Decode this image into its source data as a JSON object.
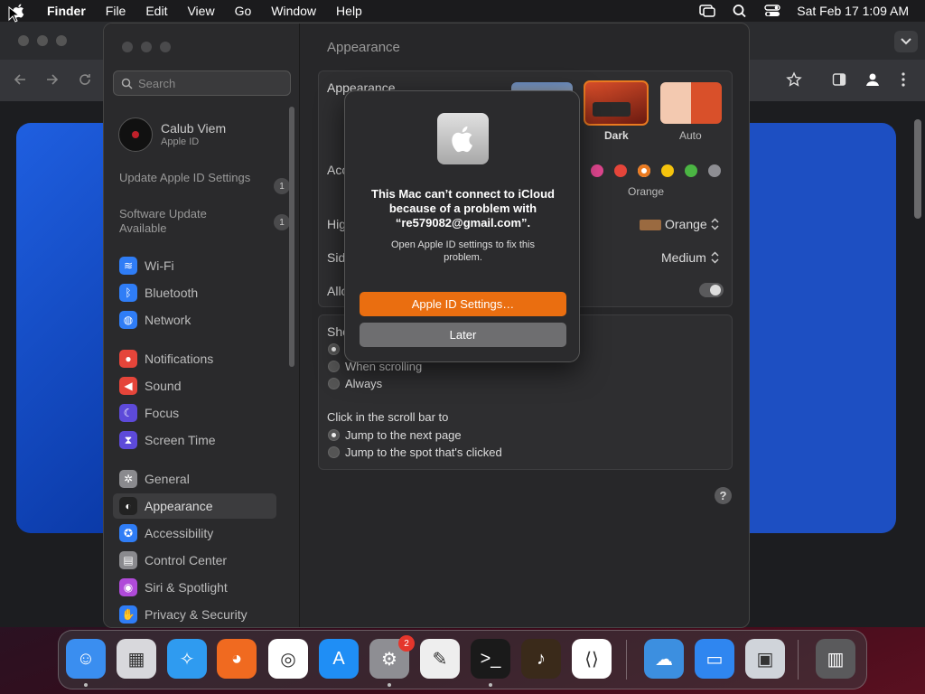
{
  "menubar": {
    "app": "Finder",
    "items": [
      "File",
      "Edit",
      "View",
      "Go",
      "Window",
      "Help"
    ],
    "datetime": "Sat Feb 17  1:09 AM"
  },
  "sidebar": {
    "search_placeholder": "Search",
    "user": {
      "name": "Calub Viem",
      "sub": "Apple ID"
    },
    "alerts": [
      {
        "label": "Update Apple ID Settings",
        "badge": "1"
      },
      {
        "label": "Software Update Available",
        "badge": "1"
      }
    ],
    "items": [
      {
        "label": "Wi-Fi",
        "icon": "wifi-icon",
        "color": "#2f7df6"
      },
      {
        "label": "Bluetooth",
        "icon": "bluetooth-icon",
        "color": "#2f7df6"
      },
      {
        "label": "Network",
        "icon": "globe-icon",
        "color": "#2f7df6"
      },
      {
        "label": "Notifications",
        "icon": "bell-icon",
        "color": "#e5453a"
      },
      {
        "label": "Sound",
        "icon": "speaker-icon",
        "color": "#e5453a"
      },
      {
        "label": "Focus",
        "icon": "moon-icon",
        "color": "#5d4ad9"
      },
      {
        "label": "Screen Time",
        "icon": "hourglass-icon",
        "color": "#5d4ad9"
      },
      {
        "label": "General",
        "icon": "gear-icon",
        "color": "#8a8a8e"
      },
      {
        "label": "Appearance",
        "icon": "appearance-icon",
        "color": "#222"
      },
      {
        "label": "Accessibility",
        "icon": "accessibility-icon",
        "color": "#2f7df6"
      },
      {
        "label": "Control Center",
        "icon": "control-center-icon",
        "color": "#8a8a8e"
      },
      {
        "label": "Siri & Spotlight",
        "icon": "siri-icon",
        "color": "#b04ad9"
      },
      {
        "label": "Privacy & Security",
        "icon": "hand-icon",
        "color": "#2f7df6"
      }
    ]
  },
  "main": {
    "title": "Appearance",
    "appearance_label": "Appearance",
    "modes": [
      "Dark",
      "Auto"
    ],
    "accent_label": "Acc",
    "accent_selected": "Orange",
    "accent_colors": [
      "#e0468f",
      "#e5453a",
      "#ea7a20",
      "#f4c30d",
      "#4bb543",
      "#8e8e93"
    ],
    "highlight_label": "Hig",
    "highlight_value": "Orange",
    "sidebar_label": "Sid",
    "sidebar_value": "Medium",
    "allow_label": "Allo",
    "scrollbar": {
      "show_label": "Sho",
      "options": [
        "When scrolling",
        "Always"
      ],
      "click_label": "Click in the scroll bar to",
      "click_options": [
        "Jump to the next page",
        "Jump to the spot that's clicked"
      ]
    },
    "help": "?"
  },
  "dialog": {
    "title": "This Mac can’t connect to iCloud because of a problem with “re579082@gmail.com”.",
    "message": "Open Apple ID settings to fix this problem.",
    "primary": "Apple ID Settings…",
    "secondary": "Later"
  },
  "dock": {
    "apps": [
      {
        "name": "finder-icon",
        "color": "#3a8ef0"
      },
      {
        "name": "launchpad-icon",
        "color": "#d8d8dc"
      },
      {
        "name": "safari-icon",
        "color": "#2f9bf0"
      },
      {
        "name": "firefox-icon",
        "color": "#f06a20"
      },
      {
        "name": "chrome-icon",
        "color": "#ffffff"
      },
      {
        "name": "app-store-icon",
        "color": "#1f8ef5"
      },
      {
        "name": "system-settings-icon",
        "color": "#8e8e93"
      },
      {
        "name": "textedit-icon",
        "color": "#eeeeee"
      },
      {
        "name": "terminal-icon",
        "color": "#1a1a1a"
      },
      {
        "name": "garageband-icon",
        "color": "#3a2a1a"
      },
      {
        "name": "vscode-icon",
        "color": "#ffffff"
      },
      {
        "name": "weather-icon",
        "color": "#3c8fe0"
      },
      {
        "name": "keynote-icon",
        "color": "#2f86f0"
      },
      {
        "name": "preview-icon",
        "color": "#d0d4da"
      },
      {
        "name": "trash-icon",
        "color": "#5a5a5c"
      }
    ],
    "settings_badge": "2"
  }
}
